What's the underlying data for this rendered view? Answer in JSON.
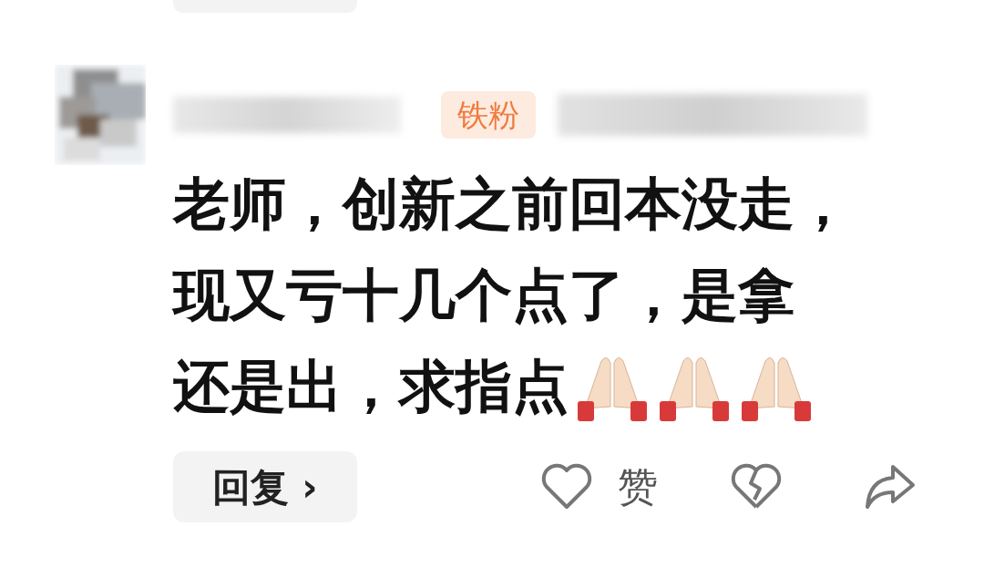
{
  "previous_reply_button": {
    "kind": "cut"
  },
  "comment": {
    "badge": "铁粉",
    "lines": [
      "老师，创新之前回本没走，",
      "现又亏十几个点了，是拿",
      "还是出，求指点"
    ],
    "emojis": [
      {
        "kind": "praying-hands"
      },
      {
        "kind": "praying-hands"
      },
      {
        "kind": "praying-hands"
      }
    ],
    "reply_button": "回复",
    "reply_arrow": "›",
    "like_label": "赞"
  }
}
